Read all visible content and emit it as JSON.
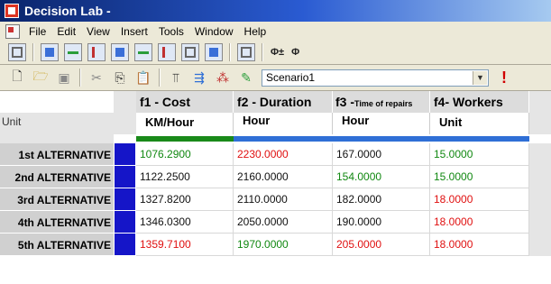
{
  "window": {
    "title": "Decision Lab -"
  },
  "menu": {
    "items": [
      "File",
      "Edit",
      "View",
      "Insert",
      "Tools",
      "Window",
      "Help"
    ]
  },
  "toolbar2": {
    "scenario_value": "Scenario1"
  },
  "grid": {
    "unit_label": "Unit",
    "columns": [
      {
        "title": "f1 - Cost",
        "unit": "KM/Hour",
        "bar_color": "#1a8a1a"
      },
      {
        "title": "f2 - Duration",
        "unit": "Hour",
        "bar_color": "#2f6fd6"
      },
      {
        "title_main": "f3 -",
        "title_small": "Time of repairs",
        "unit": "Hour",
        "bar_color": "#2f6fd6"
      },
      {
        "title": "f4- Workers",
        "unit": "Unit",
        "bar_color": "#2f6fd6"
      }
    ],
    "colors": {
      "green": "#118811",
      "red": "#e01010",
      "black": "#111111",
      "marker": "#1515c8"
    },
    "rows": [
      {
        "label": "1st ALTERNATIVE",
        "values": [
          "1076.2900",
          "2230.0000",
          "167.0000",
          "15.0000"
        ],
        "tones": [
          "green",
          "red",
          "black",
          "green"
        ]
      },
      {
        "label": "2nd ALTERNATIVE",
        "values": [
          "1122.2500",
          "2160.0000",
          "154.0000",
          "15.0000"
        ],
        "tones": [
          "black",
          "black",
          "green",
          "green"
        ]
      },
      {
        "label": "3rd ALTERNATIVE",
        "values": [
          "1327.8200",
          "2110.0000",
          "182.0000",
          "18.0000"
        ],
        "tones": [
          "black",
          "black",
          "black",
          "red"
        ]
      },
      {
        "label": "4th ALTERNATIVE",
        "values": [
          "1346.0300",
          "2050.0000",
          "190.0000",
          "18.0000"
        ],
        "tones": [
          "black",
          "black",
          "black",
          "red"
        ]
      },
      {
        "label": "5th ALTERNATIVE",
        "values": [
          "1359.7100",
          "1970.0000",
          "205.0000",
          "18.0000"
        ],
        "tones": [
          "red",
          "green",
          "red",
          "red"
        ]
      }
    ]
  }
}
